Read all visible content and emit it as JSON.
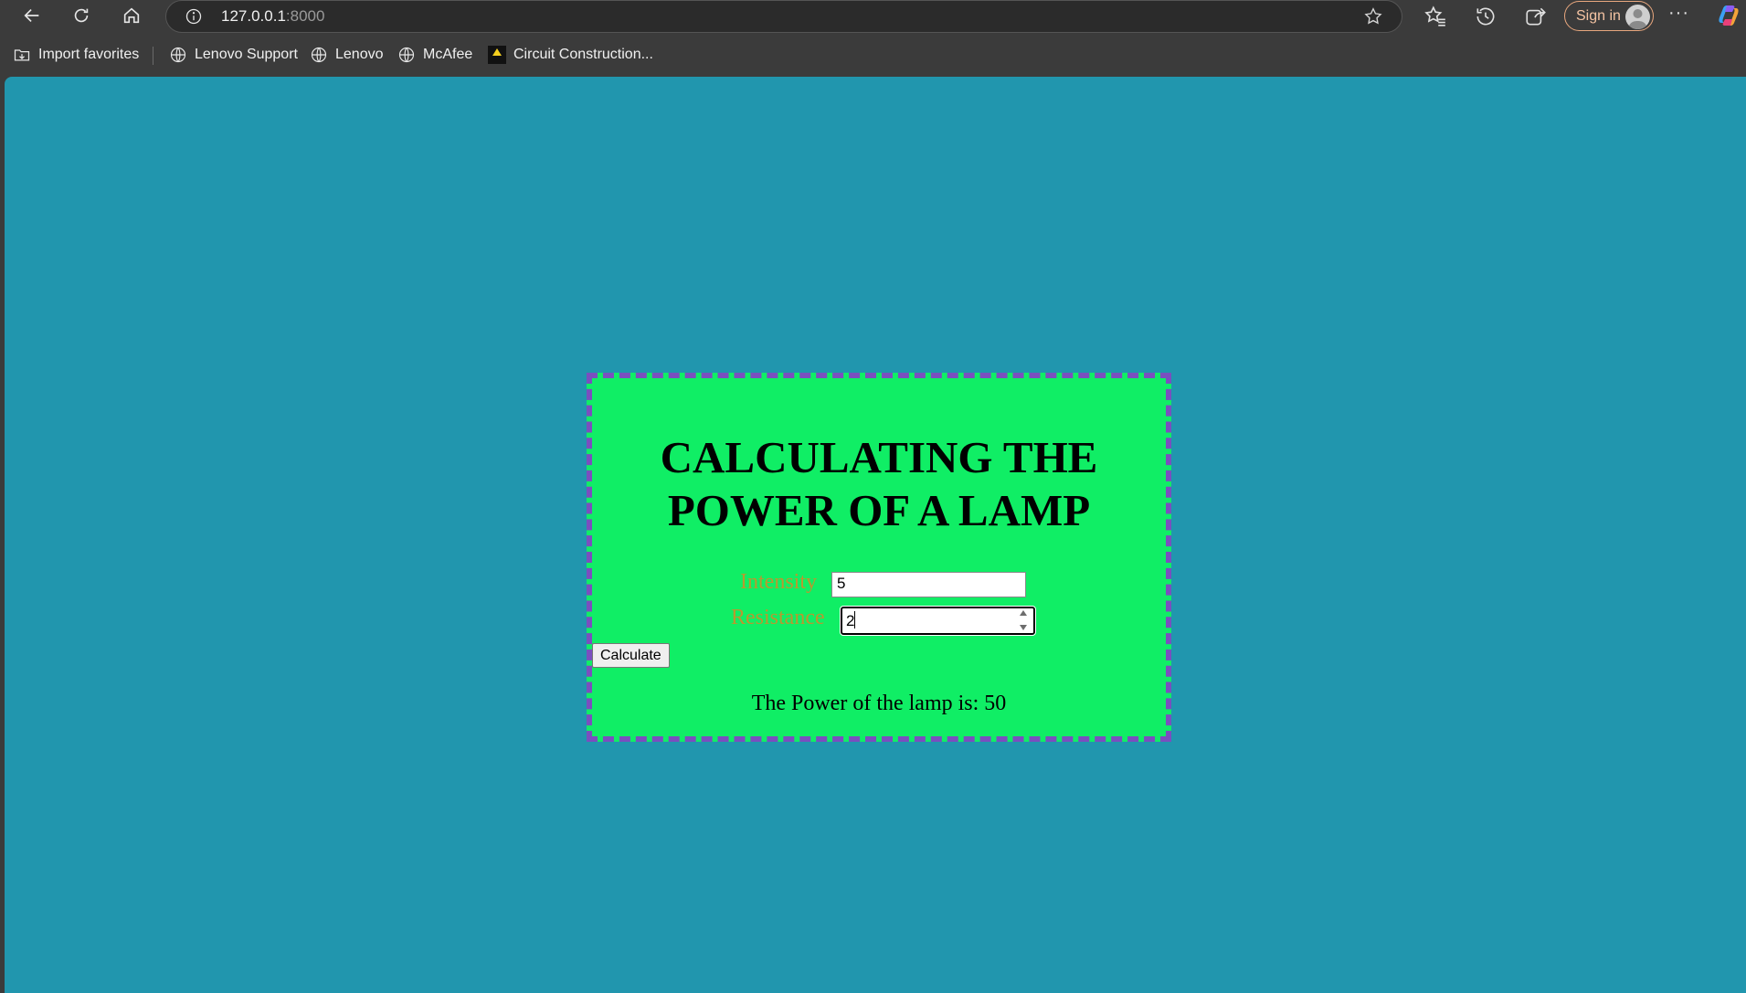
{
  "browser": {
    "url_host": "127.0.0.1",
    "url_port": ":8000",
    "sign_in_label": "Sign in",
    "more_label": "···"
  },
  "favorites": [
    {
      "label": "Import favorites",
      "icon": "import-favorites-icon"
    },
    {
      "label": "Lenovo Support",
      "icon": "globe-icon"
    },
    {
      "label": "Lenovo",
      "icon": "globe-icon"
    },
    {
      "label": "McAfee",
      "icon": "globe-icon"
    },
    {
      "label": "Circuit Construction...",
      "icon": "phet-icon"
    }
  ],
  "page": {
    "title_line1": "CALCULATING THE",
    "title_line2": "POWER OF A LAMP",
    "intensity_label": "Intensity",
    "intensity_value": "5",
    "resistance_label": "Resistance",
    "resistance_value": "2",
    "calculate_label": "Calculate",
    "result_text": "The Power of the lamp is: 50"
  },
  "colors": {
    "page_background": "#2196ae",
    "card_background": "#10ee65",
    "card_border": "#7a4fbf",
    "label_color": "#b79a2f"
  }
}
